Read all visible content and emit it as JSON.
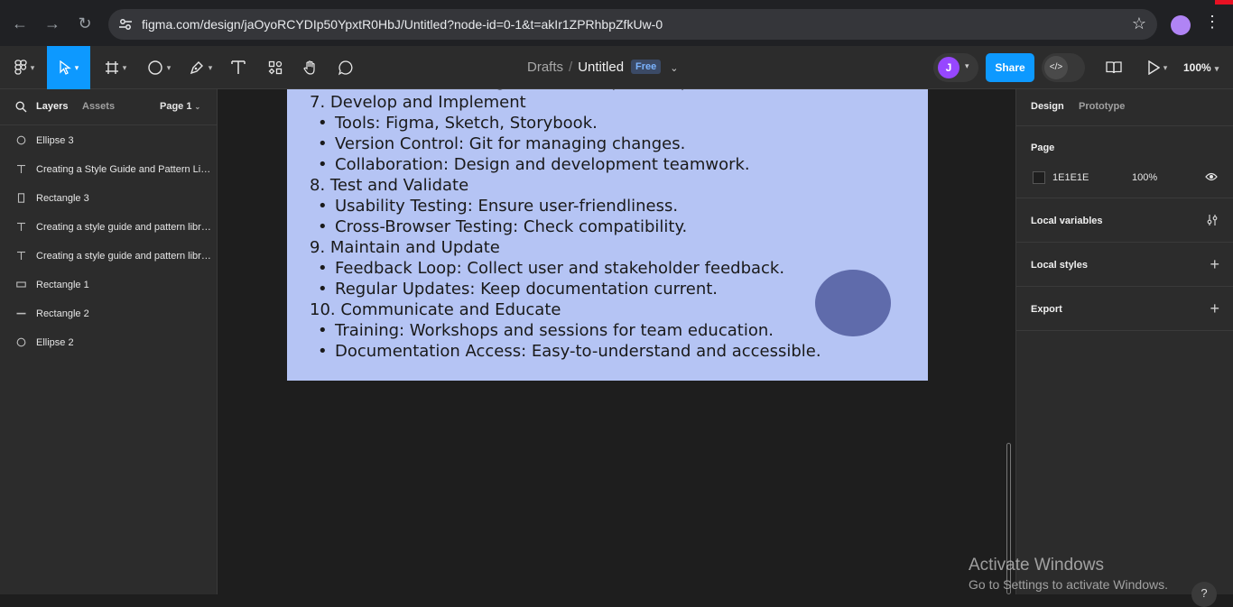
{
  "browser": {
    "url": "figma.com/design/jaOyoRCYDIp50YpxtR0HbJ/Untitled?node-id=0-1&t=akIr1ZPRhbpZfkUw-0",
    "back_icon": "arrow-left-icon",
    "forward_icon": "arrow-right-icon",
    "reload_icon": "reload-icon",
    "star_icon": "star-icon",
    "menu_icon": "kebab-icon"
  },
  "toolbar": {
    "tools": [
      {
        "name": "main-menu",
        "icon": "figma-logo-icon"
      },
      {
        "name": "move",
        "icon": "cursor-icon",
        "active": true
      },
      {
        "name": "frame",
        "icon": "frame-icon"
      },
      {
        "name": "shape",
        "icon": "ellipse-icon"
      },
      {
        "name": "pen",
        "icon": "pen-icon"
      },
      {
        "name": "text",
        "icon": "text-icon"
      },
      {
        "name": "resources",
        "icon": "components-icon"
      },
      {
        "name": "hand",
        "icon": "hand-icon"
      },
      {
        "name": "comment",
        "icon": "comment-icon"
      }
    ],
    "breadcrumb": {
      "drafts": "Drafts",
      "separator": "/",
      "title": "Untitled",
      "badge": "Free"
    },
    "avatar_initial": "J",
    "share_label": "Share",
    "zoom": "100%",
    "accent_color": "#0d99ff"
  },
  "left_panel": {
    "tabs": {
      "layers": "Layers",
      "assets": "Assets"
    },
    "page_select": "Page 1",
    "layers": [
      {
        "label": "Ellipse 3",
        "type": "ellipse"
      },
      {
        "label": "Creating a Style Guide and Pattern Library",
        "type": "text"
      },
      {
        "label": "Rectangle 3",
        "type": "rectangle-tall"
      },
      {
        "label": "Creating a style guide and pattern library",
        "type": "text"
      },
      {
        "label": "Creating a style guide and pattern library",
        "type": "text"
      },
      {
        "label": "Rectangle 1",
        "type": "rectangle-wide"
      },
      {
        "label": "Rectangle 2",
        "type": "line"
      },
      {
        "label": "Ellipse 2",
        "type": "ellipse"
      }
    ]
  },
  "canvas": {
    "frame_color": "#b5c4f4",
    "lines": [
      {
        "text": "Best Practices: Design and development tips.",
        "bullet": true
      },
      {
        "text": "7. Develop and Implement",
        "bullet": false
      },
      {
        "text": "Tools: Figma, Sketch, Storybook.",
        "bullet": true
      },
      {
        "text": "Version Control: Git for managing changes.",
        "bullet": true
      },
      {
        "text": "Collaboration: Design and development teamwork.",
        "bullet": true
      },
      {
        "text": "8. Test and Validate",
        "bullet": false
      },
      {
        "text": "Usability Testing: Ensure user-friendliness.",
        "bullet": true
      },
      {
        "text": "Cross-Browser Testing: Check compatibility.",
        "bullet": true
      },
      {
        "text": "9. Maintain and Update",
        "bullet": false
      },
      {
        "text": "Feedback Loop: Collect user and stakeholder feedback.",
        "bullet": true
      },
      {
        "text": "Regular Updates: Keep documentation current.",
        "bullet": true
      },
      {
        "text": "10. Communicate and Educate",
        "bullet": false
      },
      {
        "text": "Training: Workshops and sessions for team education.",
        "bullet": true
      },
      {
        "text": "Documentation Access: Easy-to-understand and accessible.",
        "bullet": true
      }
    ]
  },
  "right_panel": {
    "tabs": {
      "design": "Design",
      "prototype": "Prototype"
    },
    "page": {
      "title": "Page",
      "color": "1E1E1E",
      "opacity": "100%"
    },
    "local_variables": "Local variables",
    "local_styles": "Local styles",
    "export": "Export"
  },
  "watermark": {
    "title": "Activate Windows",
    "subtitle": "Go to Settings to activate Windows."
  },
  "help_label": "?"
}
